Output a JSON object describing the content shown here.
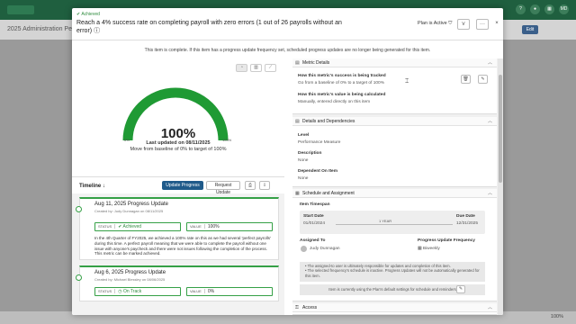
{
  "background": {
    "page_title": "2025 Administration Per",
    "edit_label": "Edit",
    "avatar_initials": "MD",
    "footer_zoom": "100%"
  },
  "modal": {
    "status": "Achieved",
    "title": "Reach a 4% success rate on completing payroll with zero errors (1 out of 26 payrolls without an error)",
    "plan_status": "Plan is Active",
    "close": "×",
    "more": "···",
    "note": "This item is complete. If this item has a progress update frequency set, scheduled progress updates are no longer being generated for this item."
  },
  "gauge": {
    "percent": 100,
    "percent_label": "100%",
    "min_label": "0%",
    "max_label": "100%",
    "last_updated": "Last updated on 08/11/2025",
    "movement": "Move from baseline of 0% to target of 100%"
  },
  "timeline": {
    "label": "Timeline",
    "update_button": "Update Progress",
    "request_button": "Request Update",
    "cards": [
      {
        "title": "Aug 11, 2025 Progress Update",
        "created": "Created by: Judy Dunnagan on 08/11/2025",
        "status_label": "STATUS",
        "status_value": "Achieved",
        "value_label": "VALUE",
        "value": "100%",
        "description": "In the 4th Quarter of FY2025, we achieved a 100% rate on this as we had several 'perfect payrolls' during this time. A perfect payroll meaning that we were able to complete the payroll without one issue with anyone's paycheck and there were not issues following the completion of the process. This metric can be marked achieved."
      },
      {
        "title": "Aug 6, 2025 Progress Update",
        "created": "Created by: Michael Blessley on 08/06/2025",
        "status_label": "STATUS",
        "status_value": "On Track",
        "value_label": "VALUE",
        "value": "0%"
      }
    ]
  },
  "metric": {
    "header": "Metric Details",
    "tracked_label": "How this metric's success is being tracked",
    "tracked_value": "Go from a baseline of 0% to a target of 100%",
    "calc_label": "How this metric's value is being calculated",
    "calc_value": "Manually, entered directly on this item"
  },
  "details": {
    "header": "Details and Dependencies",
    "level_label": "Level",
    "level_value": "Performance Measure",
    "desc_label": "Description",
    "desc_value": "None",
    "dep_label": "Dependent On Item",
    "dep_value": "None"
  },
  "schedule": {
    "header": "Schedule and Assignment",
    "timespan_label": "Item Timespan",
    "start_label": "Start Date",
    "start_value": "01/01/2024",
    "span_value": "1 YEAR",
    "due_label": "Due Date",
    "due_value": "12/31/2025",
    "assigned_label": "Assigned To",
    "assigned_value": "Judy Dunnagan",
    "freq_label": "Progress Update Frequency",
    "freq_value": "Biweekly",
    "bullet1": "The assigned-to user is ultimately responsible for updates and completion of this item.",
    "bullet2": "The selected frequency's schedule is inactive. Progress Updates will not be automatically generated for this item.",
    "plan_default": "Item is currently using the Plan's default settings for schedule and reminders"
  },
  "access": {
    "header": "Access"
  }
}
